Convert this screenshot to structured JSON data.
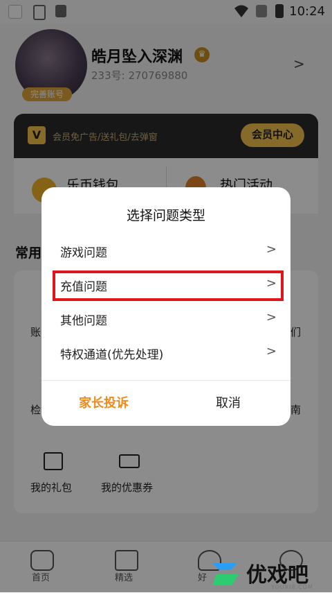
{
  "status_bar": {
    "time": "10:24",
    "icons": [
      "app-square-icon",
      "lock-icon",
      "a-icon",
      "wifi-icon",
      "no-sim-icon",
      "battery-charging-icon"
    ]
  },
  "profile": {
    "name": "皓月坠入深渊",
    "id_text": "233号: 270769880",
    "badge": "完善账号"
  },
  "vip": {
    "text": "会员免广告/送礼包/去弹窗",
    "button": "会员中心",
    "logo": "V"
  },
  "shortcuts": {
    "wallet": "乐币钱包",
    "events": "热门活动"
  },
  "common": {
    "title": "常用",
    "left_partial_1": "账",
    "left_partial_2": "检",
    "right_partial_1": "们",
    "right_partial_2": "南",
    "items": [
      {
        "label": "我的礼包",
        "icon": "gift-icon"
      },
      {
        "label": "我的优惠券",
        "icon": "coupon-icon"
      }
    ]
  },
  "tabbar": {
    "tabs": [
      {
        "label": "首页",
        "icon": "gamepad-icon"
      },
      {
        "label": "精选",
        "icon": "star-icon"
      },
      {
        "label": "好",
        "icon": "ghost-icon"
      }
    ]
  },
  "dialog": {
    "title": "选择问题类型",
    "items": [
      {
        "label": "游戏问题"
      },
      {
        "label": "充值问题"
      },
      {
        "label": "其他问题"
      },
      {
        "label": "特权通道(优先处理)"
      }
    ],
    "parent_button": "家长投诉",
    "cancel_button": "取消"
  },
  "watermark": {
    "text": "优戏吧",
    "sub": "YOUXI8.COM"
  },
  "colors": {
    "accent": "#f08a1c",
    "vip_gold": "#f3c24c",
    "highlight": "#e0141c"
  }
}
